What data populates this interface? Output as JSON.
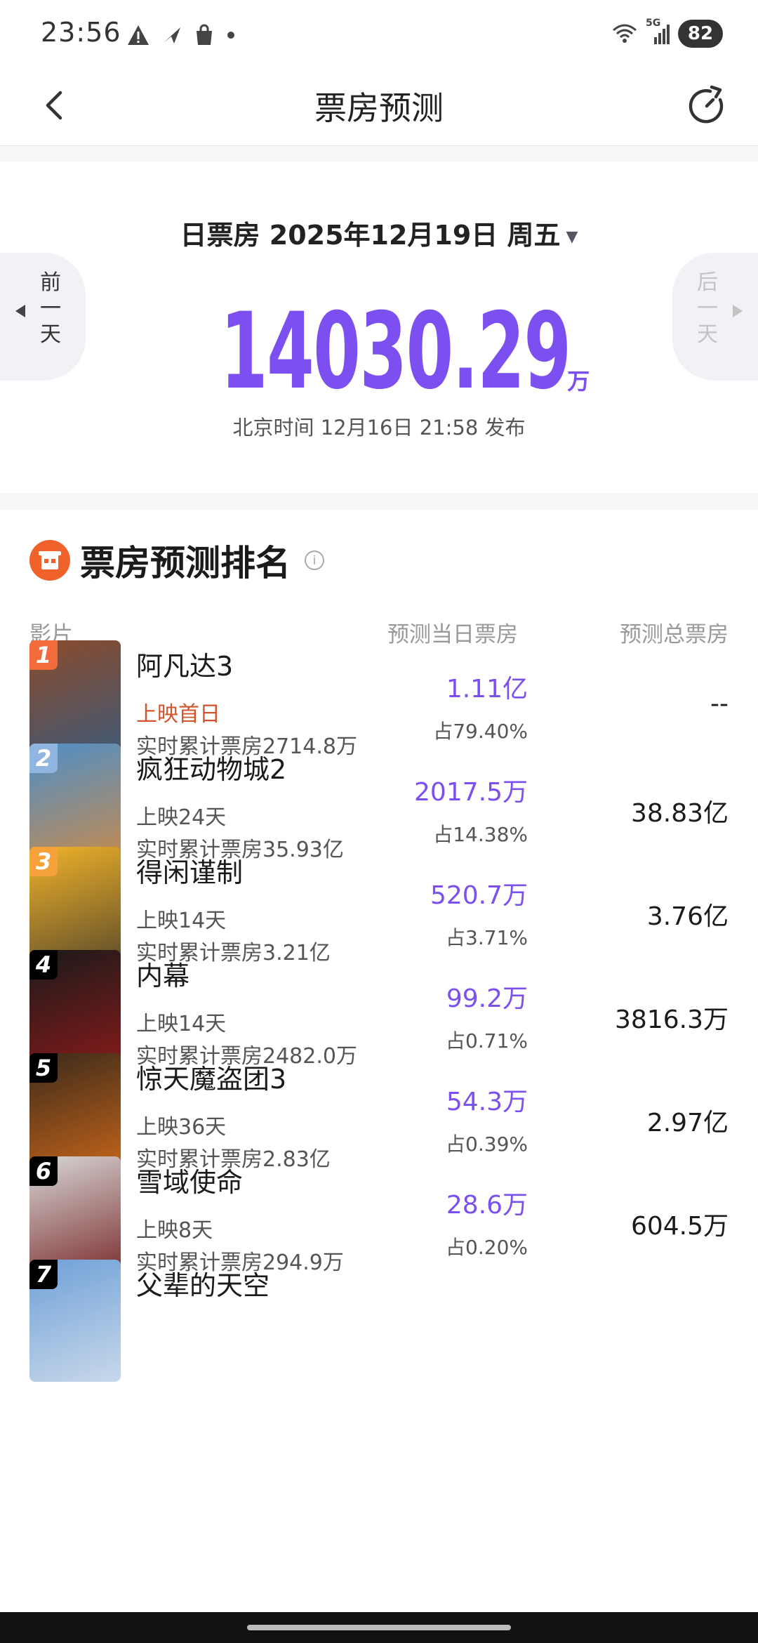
{
  "status": {
    "time": "23:56",
    "network": "5G",
    "battery": "82"
  },
  "nav": {
    "title": "票房预测"
  },
  "summary": {
    "date": "日票房 2025年12月19日 周五",
    "prev_label": "前一天",
    "next_label": "后一天",
    "total_value": "14030.29",
    "total_unit": "万",
    "publish": "北京时间 12月16日 21:58 发布"
  },
  "ranking": {
    "title": "票房预测排名",
    "columns": {
      "film": "影片",
      "daily": "预测当日票房",
      "total": "预测总票房"
    },
    "rows": [
      {
        "rank": "1",
        "name": "阿凡达3",
        "days": "上映首日",
        "cumulative": "实时累计票房2714.8万",
        "daily": "1.11亿",
        "share": "占79.40%",
        "total": "--",
        "badge_color": "#f26b3a",
        "poster_colors": [
          "#8a4a2a",
          "#3c5a7a"
        ]
      },
      {
        "rank": "2",
        "name": "疯狂动物城2",
        "days": "上映24天",
        "cumulative": "实时累计票房35.93亿",
        "daily": "2017.5万",
        "share": "占14.38%",
        "total": "38.83亿",
        "badge_color": "#8fb5e0",
        "poster_colors": [
          "#4d8fc9",
          "#c88a4a"
        ]
      },
      {
        "rank": "3",
        "name": "得闲谨制",
        "days": "上映14天",
        "cumulative": "实时累计票房3.21亿",
        "daily": "520.7万",
        "share": "占3.71%",
        "total": "3.76亿",
        "badge_color": "#f5a23a",
        "poster_colors": [
          "#f0b32a",
          "#5a4a2a"
        ]
      },
      {
        "rank": "4",
        "name": "内幕",
        "days": "上映14天",
        "cumulative": "实时累计票房2482.0万",
        "daily": "99.2万",
        "share": "占0.71%",
        "total": "3816.3万",
        "badge_color": "#000000",
        "poster_colors": [
          "#1a1a1a",
          "#8a1a1a"
        ]
      },
      {
        "rank": "5",
        "name": "惊天魔盗团3",
        "days": "上映36天",
        "cumulative": "实时累计票房2.83亿",
        "daily": "54.3万",
        "share": "占0.39%",
        "total": "2.97亿",
        "badge_color": "#000000",
        "poster_colors": [
          "#3a2a1a",
          "#c9661a"
        ]
      },
      {
        "rank": "6",
        "name": "雪域使命",
        "days": "上映8天",
        "cumulative": "实时累计票房294.9万",
        "daily": "28.6万",
        "share": "占0.20%",
        "total": "604.5万",
        "badge_color": "#000000",
        "poster_colors": [
          "#d8d8d8",
          "#7a2a2a"
        ]
      },
      {
        "rank": "7",
        "name": "父辈的天空",
        "days": "",
        "cumulative": "",
        "daily": "",
        "share": "",
        "total": "",
        "badge_color": "#000000",
        "poster_colors": [
          "#6fa0d8",
          "#c8d8ea"
        ]
      }
    ]
  }
}
